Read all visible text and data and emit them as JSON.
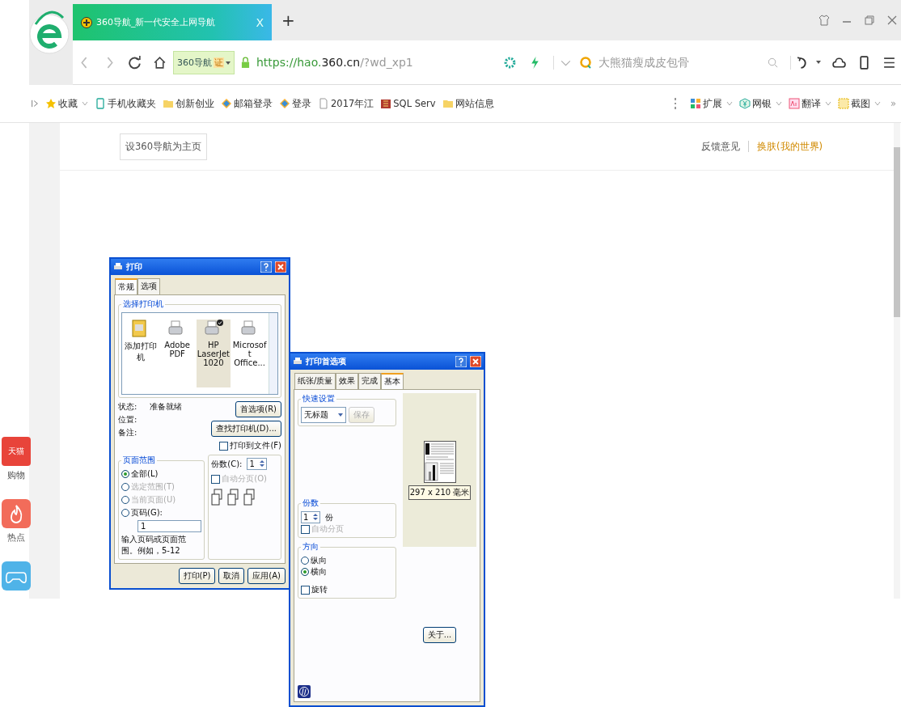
{
  "tabs": [
    {
      "title": "360导航_新一代安全上网导航",
      "close_glyph": "X",
      "selected": true
    }
  ],
  "new_tab_glyph": "+",
  "address_bar": {
    "site_label": "360导航",
    "cert_badge": "证",
    "url_prefix": "https://hao.",
    "url_domain": "360.cn",
    "url_path": "/?wd_xp1"
  },
  "search": {
    "placeholder": "大熊猫瘦成皮包骨"
  },
  "bookmarks": [
    {
      "kind": "star",
      "label": "收藏",
      "dropdown": true
    },
    {
      "kind": "phone",
      "label": "手机收藏夹",
      "dropdown": false
    },
    {
      "kind": "folder",
      "label": "创新创业",
      "dropdown": false
    },
    {
      "kind": "diamond",
      "label": "邮箱登录",
      "dropdown": false
    },
    {
      "kind": "diamond",
      "label": "登录",
      "dropdown": false
    },
    {
      "kind": "page",
      "label": "2017年江",
      "dropdown": false
    },
    {
      "kind": "db",
      "label": "SQL Serv",
      "dropdown": false
    },
    {
      "kind": "folder",
      "label": "网站信息",
      "dropdown": false
    }
  ],
  "tools": [
    {
      "kind": "grid",
      "label": "扩展"
    },
    {
      "kind": "yen",
      "label": "网银"
    },
    {
      "kind": "translate",
      "label": "翻译"
    },
    {
      "kind": "crop",
      "label": "截图"
    }
  ],
  "more_glyph": "»",
  "page": {
    "set_home_button": "设360导航为主页",
    "feedback_link": "反馈意见",
    "skin_link": "换肤(我的世界)"
  },
  "side_dock": [
    {
      "kind": "tmall",
      "badge": "天猫",
      "label": "购物"
    },
    {
      "kind": "fire",
      "label": "热点"
    },
    {
      "kind": "game"
    }
  ],
  "print_dialog": {
    "title": "打印",
    "tabs": [
      {
        "label": "常规",
        "selected": true
      },
      {
        "label": "选项",
        "selected": false
      }
    ],
    "printer_group": "选择打印机",
    "printers": [
      {
        "kind": "add",
        "label": "添加打印机",
        "selected": false,
        "default": false
      },
      {
        "kind": "printer",
        "label": "Adobe PDF",
        "selected": false,
        "default": false
      },
      {
        "kind": "printer",
        "label": "HP LaserJet 1020",
        "selected": true,
        "default": true
      },
      {
        "kind": "printer",
        "label": "Microsoft Office...",
        "selected": false,
        "default": false
      }
    ],
    "status_label": "状态:",
    "status_value": "准备就绪",
    "location_label": "位置:",
    "comment_label": "备注:",
    "preferences_button": "首选项(R)",
    "find_printer_button": "查找打印机(D)...",
    "print_to_file": {
      "label": "打印到文件(F)",
      "checked": false
    },
    "range_group": "页面范围",
    "range_options": [
      {
        "label": "全部(L)",
        "selected": true,
        "disabled": false
      },
      {
        "label": "选定范围(T)",
        "selected": false,
        "disabled": true
      },
      {
        "label": "当前页面(U)",
        "selected": false,
        "disabled": true
      },
      {
        "label": "页码(G):",
        "selected": false,
        "disabled": false
      }
    ],
    "pages_value": "1",
    "range_hint": "输入页码或页面范围。例如，5-12",
    "copies_label": "份数(C):",
    "copies_value": "1",
    "collate": {
      "label": "自动分页(O)",
      "checked": false,
      "disabled": true
    },
    "buttons": [
      "打印(P)",
      "取消",
      "应用(A)"
    ]
  },
  "prefs_dialog": {
    "title": "打印首选项",
    "tabs": [
      {
        "label": "纸张/质量",
        "selected": false
      },
      {
        "label": "效果",
        "selected": false
      },
      {
        "label": "完成",
        "selected": false
      },
      {
        "label": "基本",
        "selected": true
      }
    ],
    "quick_group": "快速设置",
    "quick_value": "无标题",
    "save_button": "保存",
    "copies_group": "份数",
    "copies_value": "1",
    "copies_unit": "份",
    "collate": {
      "label": "自动分页",
      "checked": false,
      "disabled": true
    },
    "orientation_group": "方向",
    "orientations": [
      {
        "label": "纵向",
        "selected": false
      },
      {
        "label": "横向",
        "selected": true
      }
    ],
    "rotate": {
      "label": "旋转",
      "checked": false
    },
    "paper_size": "297 x 210 毫米",
    "about_button": "关于..."
  }
}
